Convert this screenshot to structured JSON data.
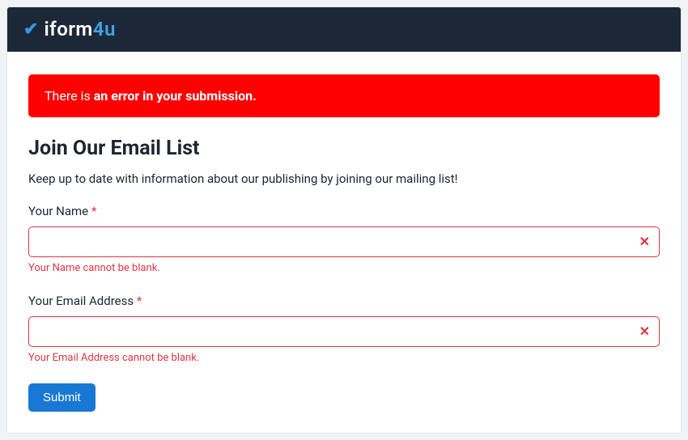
{
  "header": {
    "logo_iform": "iform",
    "logo_4u": "4u"
  },
  "alert": {
    "prefix": "There is ",
    "strong": "an error in your submission."
  },
  "page": {
    "title": "Join Our Email List",
    "description": "Keep up to date with information about our publishing by joining our mailing list!"
  },
  "form": {
    "fields": {
      "name": {
        "label": "Your Name ",
        "required_mark": "*",
        "value": "",
        "error": "Your Name cannot be blank."
      },
      "email": {
        "label": "Your Email Address ",
        "required_mark": "*",
        "value": "",
        "error": "Your Email Address cannot be blank."
      }
    },
    "submit_label": "Submit"
  },
  "colors": {
    "error": "#dc3545",
    "accent": "#1978d4",
    "header_bg": "#1c2738",
    "alert_bg": "#ff0000"
  }
}
